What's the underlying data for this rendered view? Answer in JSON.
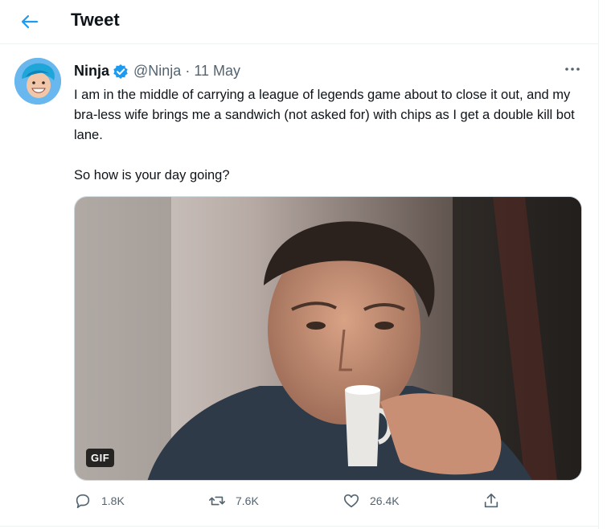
{
  "header": {
    "title": "Tweet",
    "back_icon": "arrow-left-icon"
  },
  "tweet": {
    "author_name": "Ninja",
    "verified_icon": "verified-badge-icon",
    "handle": "@Ninja",
    "separator": "·",
    "date": "11 May",
    "more_icon": "more-horizontal-icon",
    "text_lines": [
      "I am in the middle of carrying a league of legends game about to close it out, and my bra-less wife brings me a sandwich (not asked for) with chips as I get a double kill bot lane.",
      "So how is your day going?"
    ],
    "media": {
      "badge": "GIF"
    },
    "actions": {
      "replies": "1.8K",
      "retweets": "7.6K",
      "likes": "26.4K",
      "reply_icon": "reply-icon",
      "retweet_icon": "retweet-icon",
      "like_icon": "heart-icon",
      "share_icon": "share-icon"
    }
  },
  "colors": {
    "accent": "#1d9bf0",
    "text": "#0f1419",
    "secondary": "#536471",
    "border": "#eff3f4"
  }
}
